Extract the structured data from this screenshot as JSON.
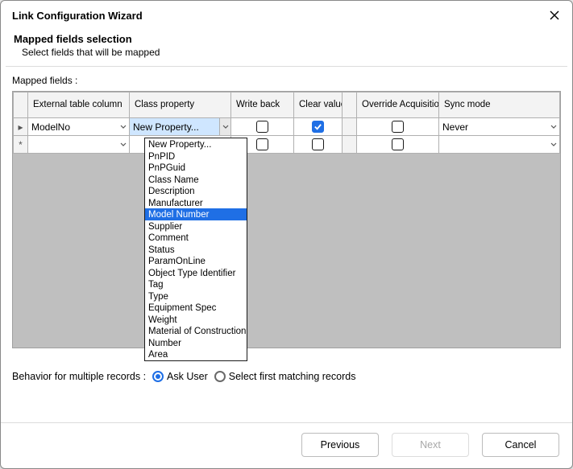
{
  "window": {
    "title": "Link Configuration Wizard"
  },
  "header": {
    "title": "Mapped fields selection",
    "subtitle": "Select fields that will be mapped"
  },
  "gridLabel": "Mapped fields :",
  "columns": {
    "external": "External table column",
    "classprop": "Class property",
    "writeback": "Write back",
    "clearvalue": "Clear value",
    "override": "Override Acquisition Mode",
    "syncmode": "Sync mode"
  },
  "rows": [
    {
      "marker": "▸",
      "external": "ModelNo",
      "classprop": "New Property...",
      "writeback": false,
      "clearvalue": true,
      "override": false,
      "syncmode": "Never",
      "classOpen": true
    },
    {
      "marker": "*",
      "external": "",
      "classprop": "",
      "writeback": false,
      "clearvalue": false,
      "override": false,
      "syncmode": "",
      "classOpen": false
    }
  ],
  "dropdown": {
    "highlightIndex": 6,
    "items": [
      "New Property...",
      "PnPID",
      "PnPGuid",
      "Class Name",
      "Description",
      "Manufacturer",
      "Model Number",
      "Supplier",
      "Comment",
      "Status",
      "ParamOnLine",
      "Object Type Identifier",
      "Tag",
      "Type",
      "Equipment Spec",
      "Weight",
      "Material of Construction",
      "Number",
      "Area"
    ]
  },
  "behavior": {
    "label": "Behavior for multiple records :",
    "options": {
      "ask": "Ask User",
      "first": "Select first matching records"
    },
    "selected": "ask"
  },
  "buttons": {
    "previous": "Previous",
    "next": "Next",
    "cancel": "Cancel"
  }
}
